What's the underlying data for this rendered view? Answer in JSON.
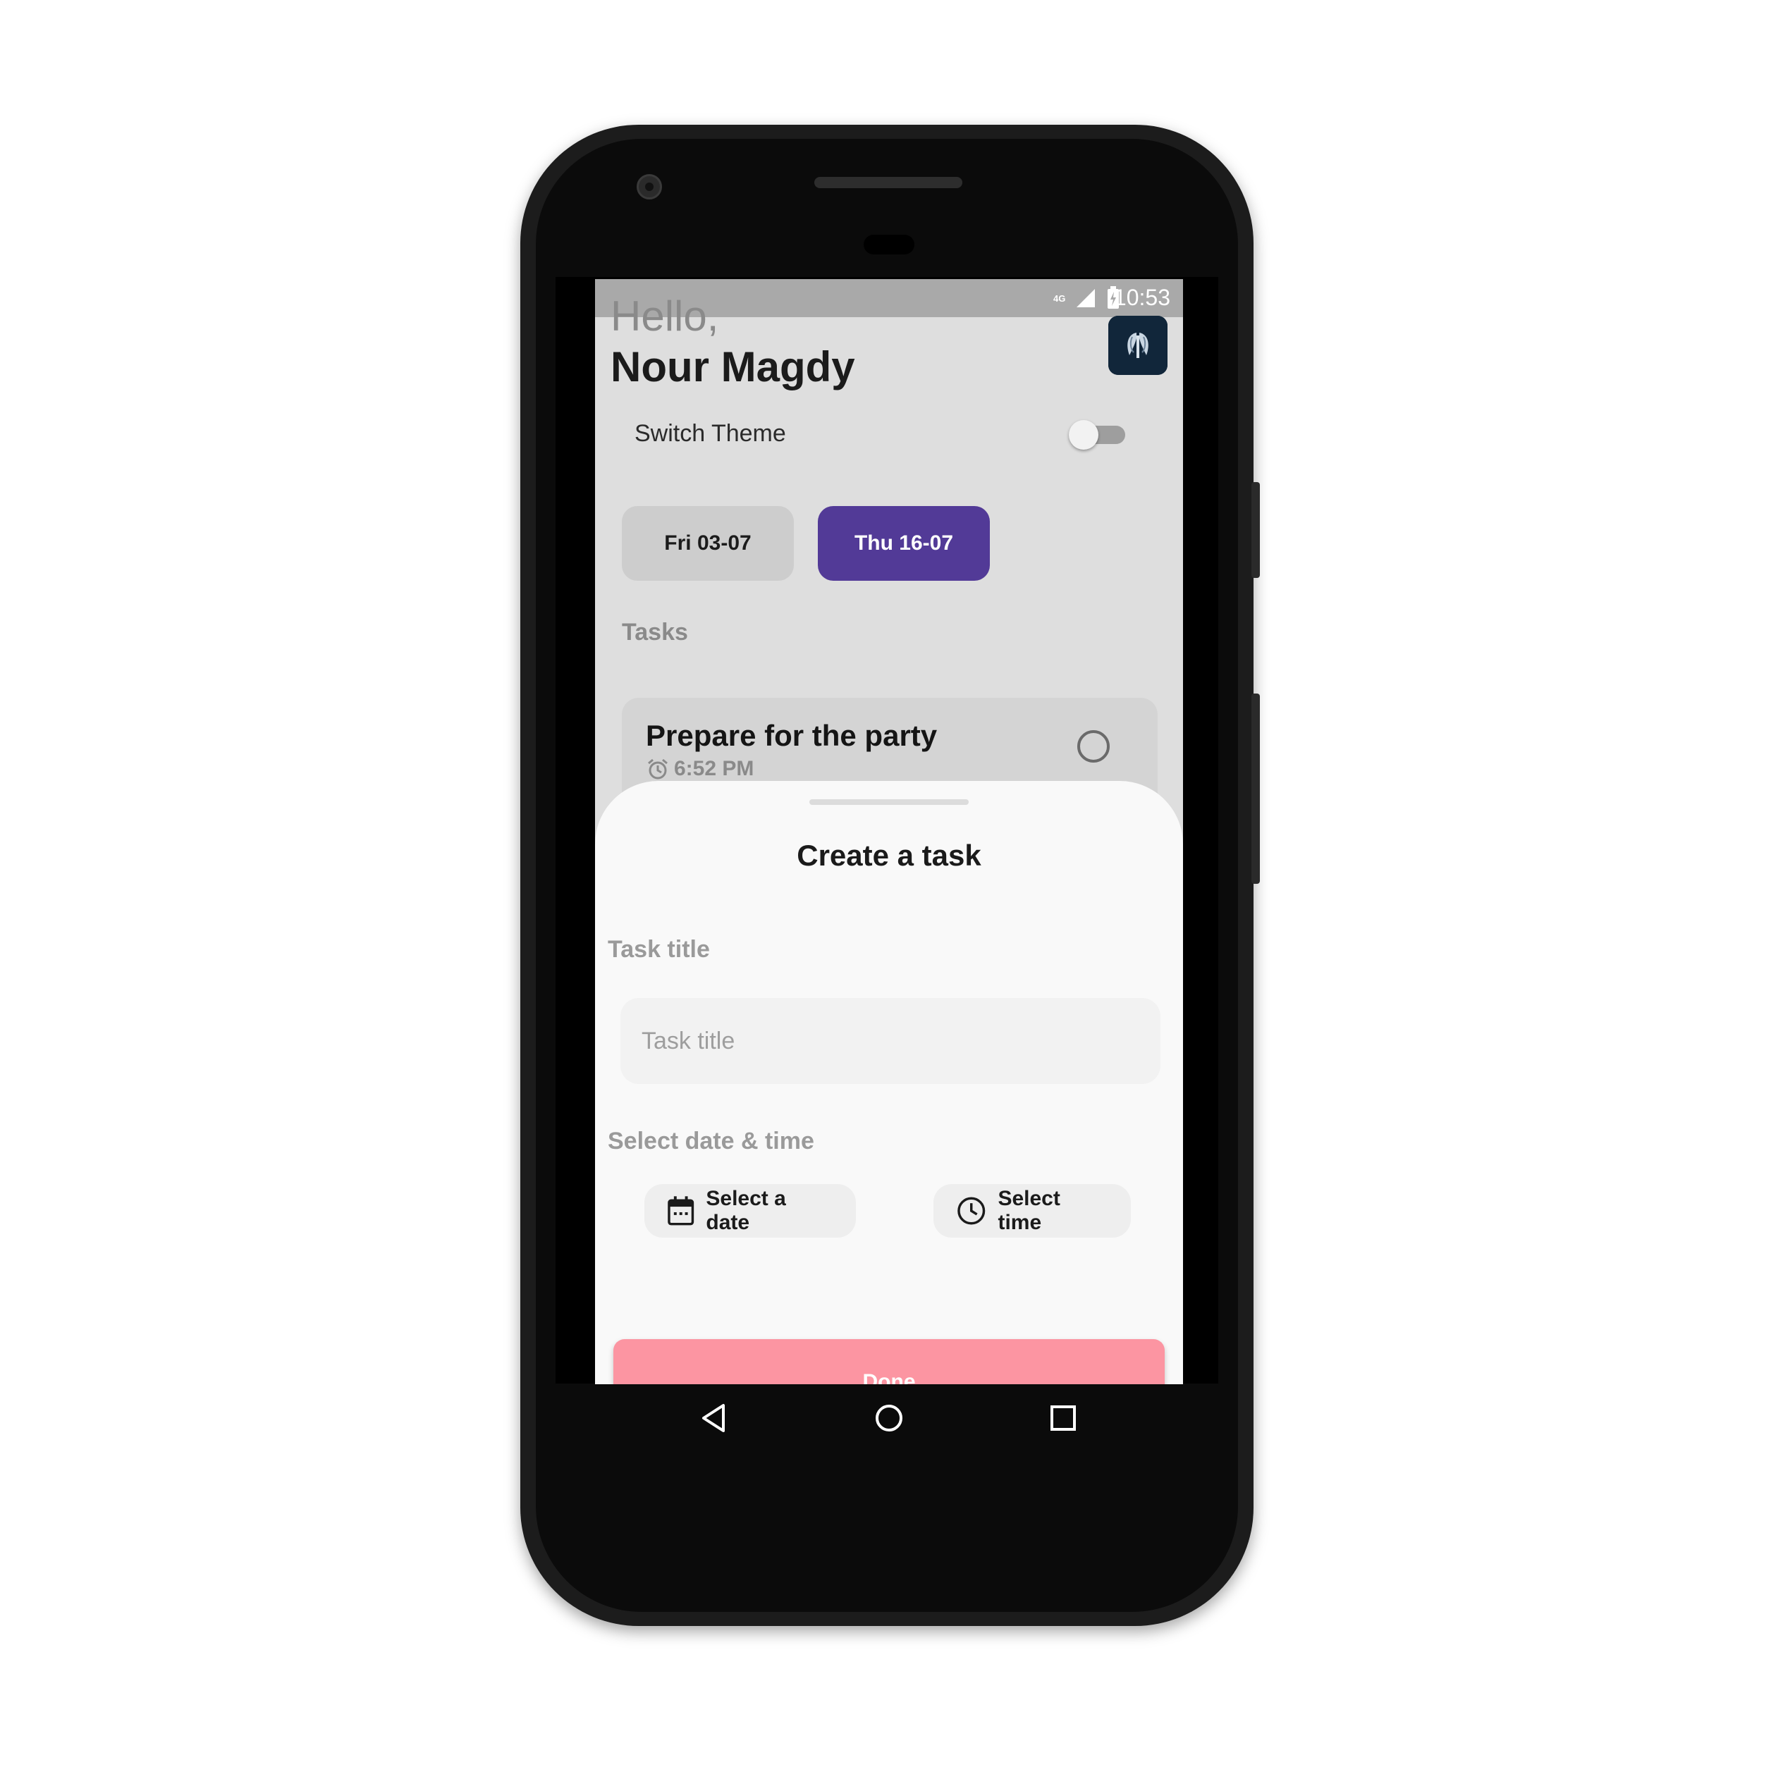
{
  "status_bar": {
    "network": "4G",
    "time": "10:53"
  },
  "header": {
    "greeting": "Hello,",
    "user_name": "Nour Magdy"
  },
  "theme_switch": {
    "label": "Switch Theme",
    "on": false
  },
  "dates": [
    {
      "label": "Fri 03-07",
      "selected": false
    },
    {
      "label": "Thu 16-07",
      "selected": true
    }
  ],
  "tasks": {
    "heading": "Tasks",
    "items": [
      {
        "title": "Prepare for the party",
        "time": "6:52 PM",
        "done": false
      }
    ]
  },
  "sheet": {
    "title": "Create a task",
    "task_title_label": "Task title",
    "task_title_placeholder": "Task title",
    "datetime_label": "Select date & time",
    "date_button": "Select a date",
    "time_button": "Select time",
    "done_button": "Done"
  },
  "colors": {
    "accent": "#523a97",
    "done": "#fc95a2",
    "status_bar": "#a9a9a9"
  },
  "icons": {
    "calendar": "calendar-icon",
    "clock": "clock-icon",
    "alarm": "alarm-icon",
    "nav_back": "back-triangle-icon",
    "nav_home": "home-circle-icon",
    "nav_recents": "recents-square-icon"
  }
}
